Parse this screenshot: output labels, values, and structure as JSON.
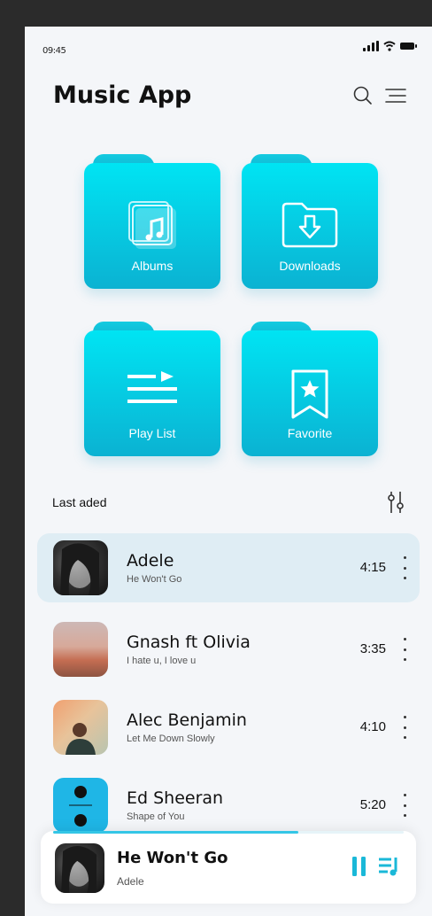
{
  "status": {
    "time": "09:45"
  },
  "header": {
    "title": "Music App"
  },
  "folders": [
    {
      "label": "Albums"
    },
    {
      "label": "Downloads"
    },
    {
      "label": "Play List"
    },
    {
      "label": "Favorite"
    }
  ],
  "section": {
    "title": "Last aded"
  },
  "songs": [
    {
      "artist": "Adele",
      "song": "He Won't Go",
      "duration": "4:15"
    },
    {
      "artist": "Gnash ft Olivia",
      "song": "I hate u, I love u",
      "duration": "3:35"
    },
    {
      "artist": "Alec Benjamin",
      "song": "Let Me Down Slowly",
      "duration": "4:10"
    },
    {
      "artist": "Ed Sheeran",
      "song": "Shape of You",
      "duration": "5:20"
    }
  ],
  "player": {
    "title": "He Won't Go",
    "artist": "Adele",
    "progress": 0.7
  },
  "colors": {
    "accent": "#00d4ec",
    "accent_dark": "#0aa9cc"
  }
}
